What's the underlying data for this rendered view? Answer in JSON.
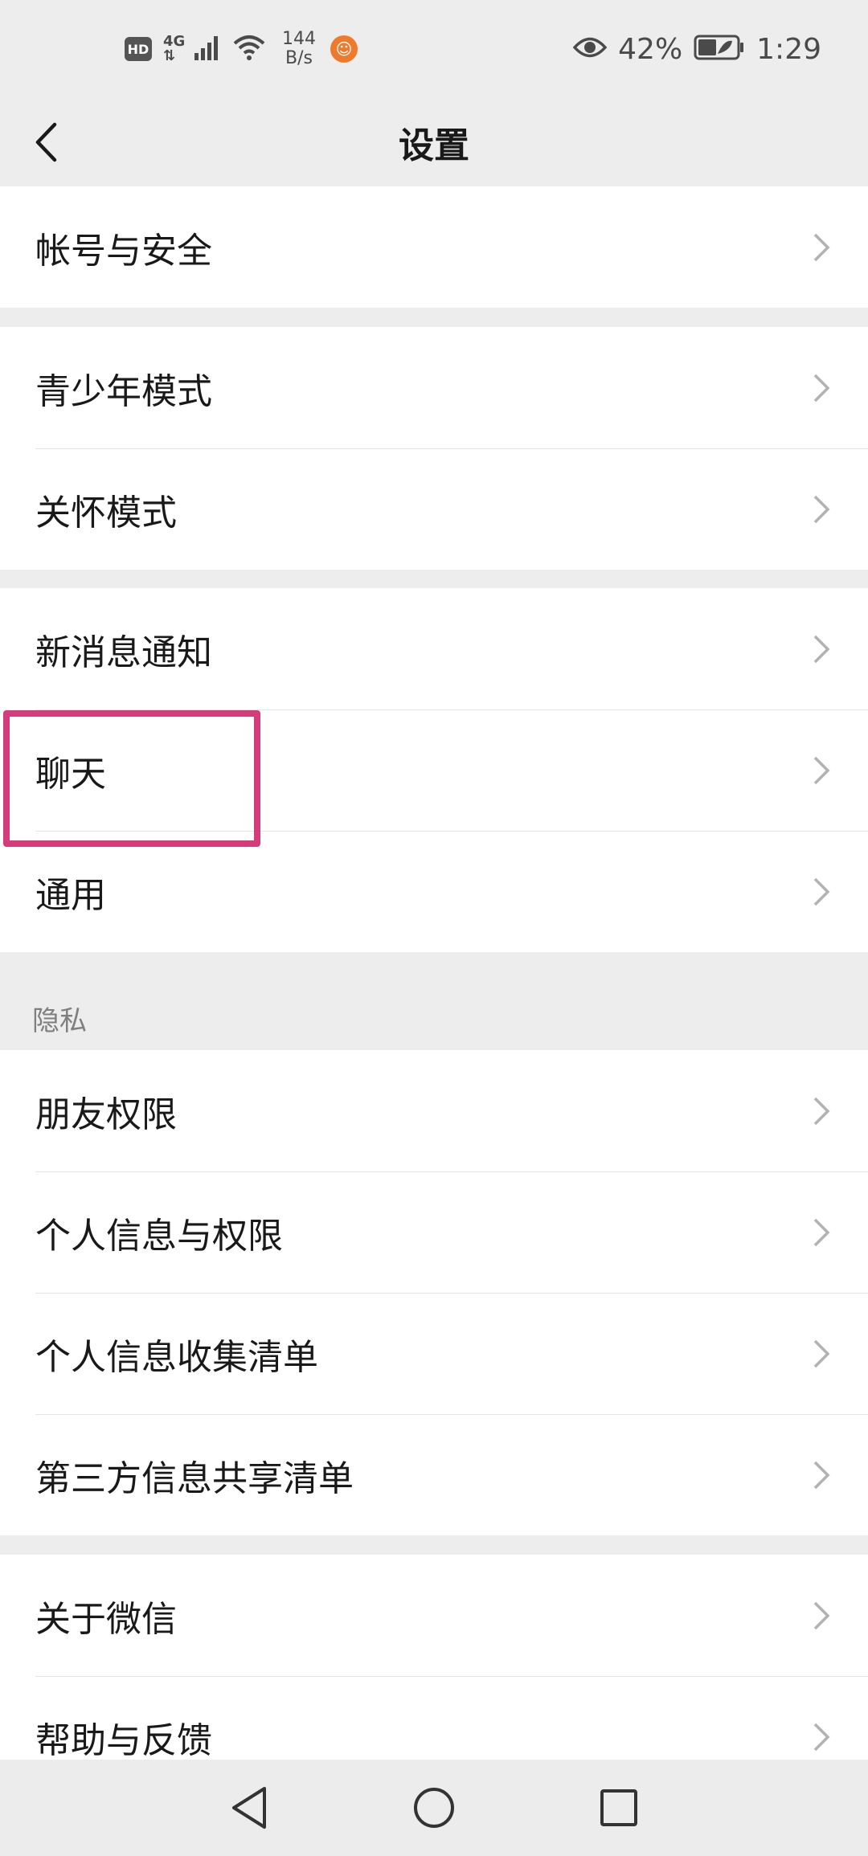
{
  "status_bar": {
    "hd": "HD",
    "network_type": "4G",
    "network_sub": "⇅",
    "speed_value": "144",
    "speed_unit": "B/s",
    "battery_percent": "42%",
    "time": "1:29",
    "icons": [
      "hd-icon",
      "signal-icon",
      "wifi-icon",
      "app-notification-icon",
      "eye-icon",
      "battery-icon"
    ]
  },
  "header": {
    "title": "设置",
    "back_icon": "chevron-left-icon"
  },
  "groups": [
    {
      "items": [
        "帐号与安全"
      ]
    },
    {
      "items": [
        "青少年模式",
        "关怀模式"
      ]
    },
    {
      "items": [
        "新消息通知",
        "聊天",
        "通用"
      ]
    },
    {
      "section_label": "隐私",
      "items": [
        "朋友权限",
        "个人信息与权限",
        "个人信息收集清单",
        "第三方信息共享清单"
      ]
    },
    {
      "items": [
        "关于微信",
        "帮助与反馈"
      ]
    }
  ],
  "highlight": {
    "target": "聊天",
    "color": "#d63b7a"
  },
  "colors": {
    "page_background": "#ededed",
    "card_background": "#ffffff",
    "text_primary": "#191919",
    "text_secondary": "#7f7f7f",
    "chevron": "#b2b2b2"
  },
  "nav_bar": {
    "icons": [
      "back-triangle-icon",
      "home-circle-icon",
      "recents-square-icon"
    ]
  }
}
